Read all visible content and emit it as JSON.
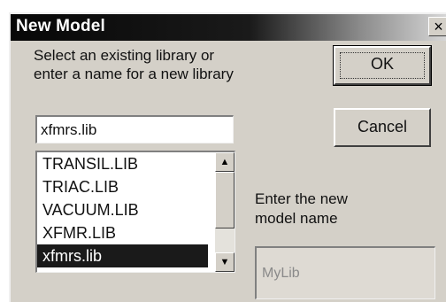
{
  "dialog": {
    "title": "New Model",
    "close_glyph": "×",
    "prompt": "Select an existing library or\nenter a name for a new library",
    "ok_label": "OK",
    "cancel_label": "Cancel",
    "library_input_value": "xfmrs.lib",
    "library_list": {
      "items": [
        "TRANSIL.LIB",
        "TRIAC.LIB",
        "VACUUM.LIB",
        "XFMR.LIB",
        "xfmrs.lib"
      ],
      "selected_index": 4
    },
    "scroll_up_icon": "▲",
    "scroll_down_icon": "▼",
    "model_name_label": "Enter the new\nmodel name",
    "model_name_value": "MyLib"
  },
  "colors": {
    "dialog_face": "#d4d0c8",
    "titlebar_dark": "#070707",
    "selection": "#1a1a1a"
  },
  "icons": {
    "close": "close-icon",
    "scroll_up": "arrow-up-icon",
    "scroll_down": "arrow-down-icon"
  }
}
